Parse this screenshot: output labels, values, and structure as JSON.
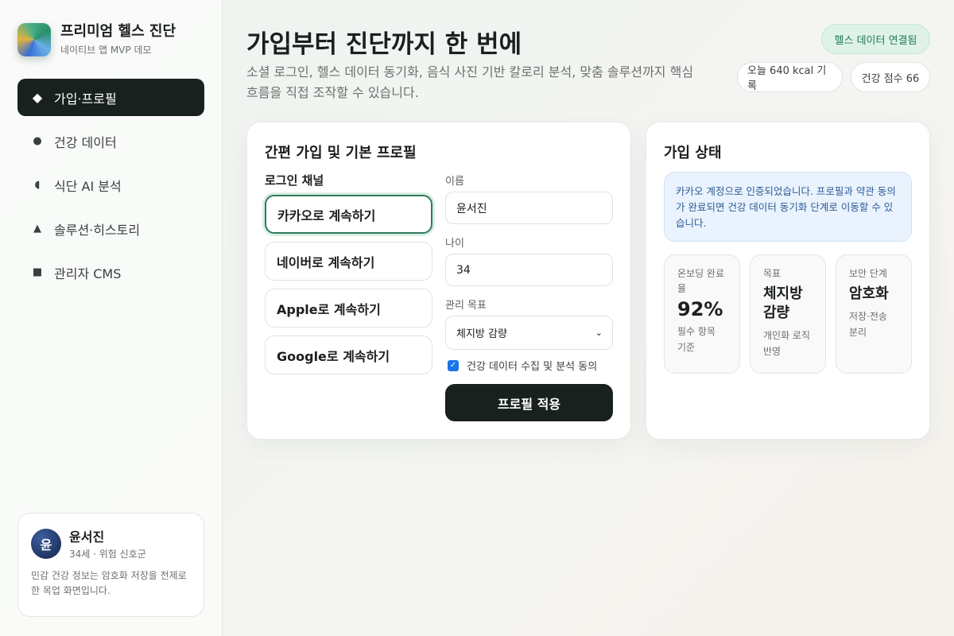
{
  "brand": {
    "title": "프리미엄 헬스 진단",
    "subtitle": "네이티브 앱 MVP 데모"
  },
  "nav": {
    "items": [
      {
        "label": "가입·프로필",
        "icon": "diamond-icon",
        "active": true
      },
      {
        "label": "건강 데이터",
        "icon": "dot-icon",
        "active": false
      },
      {
        "label": "식단 AI 분석",
        "icon": "half-circle-icon",
        "active": false
      },
      {
        "label": "솔루션·히스토리",
        "icon": "triangle-icon",
        "active": false
      },
      {
        "label": "관리자 CMS",
        "icon": "square-icon",
        "active": false
      }
    ]
  },
  "user": {
    "avatar_initial": "윤",
    "name": "윤서진",
    "detail": "34세 · 위험 신호군",
    "note": "민감 건강 정보는 암호화 저장을 전제로 한 목업 화면입니다."
  },
  "header": {
    "title": "가입부터 진단까지 한 번에",
    "description": "소셜 로그인, 헬스 데이터 동기화, 음식 사진 기반 칼로리 분석, 맞춤 솔루션까지 핵심 흐름을 직접 조작할 수 있습니다.",
    "status_pill": "헬스 데이터 연결됨",
    "kcal_pill": "오늘 640 kcal 기록",
    "score_pill": "건강 점수 66"
  },
  "signup": {
    "title": "간편 가입 및 기본 프로필",
    "channel_label": "로그인 채널",
    "channels": [
      {
        "label": "카카오로 계속하기",
        "selected": true
      },
      {
        "label": "네이버로 계속하기",
        "selected": false
      },
      {
        "label": "Apple로 계속하기",
        "selected": false
      },
      {
        "label": "Google로 계속하기",
        "selected": false
      }
    ],
    "name_label": "이름",
    "name_value": "윤서진",
    "age_label": "나이",
    "age_value": "34",
    "goal_label": "관리 목표",
    "goal_value": "체지방 감량",
    "consent_label": "건강 데이터 수집 및 분석 동의",
    "consent_checked": true,
    "apply_label": "프로필 적용"
  },
  "status": {
    "title": "가입 상태",
    "notice": "카카오 계정으로 인증되었습니다. 프로필과 약관 동의가 완료되면 건강 데이터 동기화 단계로 이동할 수 있습니다.",
    "stats": [
      {
        "label": "온보딩 완료율",
        "value": "92%",
        "note": "필수 항목 기준"
      },
      {
        "label": "목표",
        "value": "체지방 감량",
        "note": "개인화 로직 반영"
      },
      {
        "label": "보안 단계",
        "value": "암호화",
        "note": "저장·전송 분리"
      }
    ]
  },
  "colors": {
    "primary_dark": "#18211e",
    "accent_green": "#2e7a5c",
    "notice_blue": "#2c5a96",
    "pill_green_bg": "#dff2e8"
  }
}
